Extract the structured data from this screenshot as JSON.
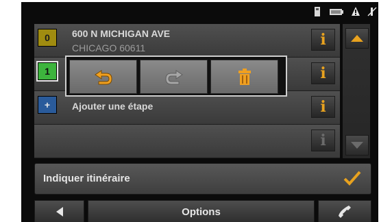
{
  "status_bar": {
    "icons": [
      "device-icon",
      "battery-icon",
      "alert-icon",
      "gps-signal-icon"
    ]
  },
  "route": {
    "stops": [
      {
        "number": "0",
        "line1": "600 N MICHIGAN AVE",
        "line2": "CHICAGO 60611",
        "badge_color": "#a08c10"
      },
      {
        "number": "1",
        "line1": "",
        "line2": "",
        "badge_color": "#3db43d"
      },
      {
        "number": "+",
        "line1": "Ajouter une étape",
        "line2": "",
        "badge_color": "#2a5b9b"
      },
      {
        "number": "",
        "line1": "",
        "line2": "",
        "badge_color": ""
      }
    ],
    "info_label": "i"
  },
  "popup": {
    "actions": [
      "undo-arrow-icon",
      "swap-arrow-icon",
      "trash-icon"
    ]
  },
  "itinerary": {
    "label": "Indiquer itinéraire"
  },
  "bottom_bar": {
    "back_icon": "back-arrow-icon",
    "options_label": "Options",
    "phone_icon": "phone-icon"
  },
  "colors": {
    "accent": "#e8a21f",
    "background": "#0b0b0b"
  }
}
